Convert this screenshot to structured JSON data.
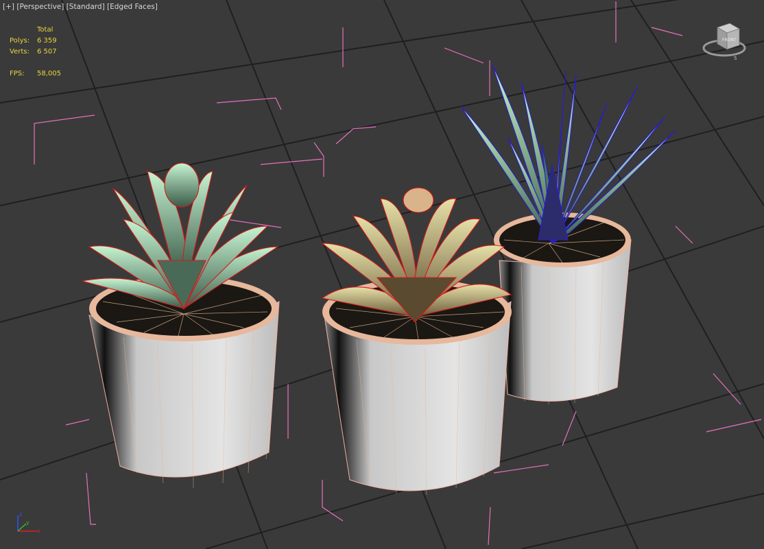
{
  "viewport": {
    "labels": [
      "[+]",
      "[Perspective]",
      "[Standard]",
      "[Edged Faces]"
    ]
  },
  "stats": {
    "header": "Total",
    "polys_label": "Polys:",
    "polys_value": "6 359",
    "verts_label": "Verts:",
    "verts_value": "6 507",
    "fps_label": "FPS:",
    "fps_value": "58,005"
  },
  "viewcube": {
    "face_label": "FRONT",
    "compass_label": "S",
    "icon": "viewcube-icon"
  },
  "axis_tripod": {
    "x_label": "x",
    "y_label": "y",
    "z_label": "z"
  },
  "colors": {
    "background": "#3a3a3a",
    "grid": "#1e1e1e",
    "bbox": "#e870c0",
    "wire_selected": "#e02020",
    "wire_agave": "#2a1ec8",
    "leaf_green": "#a8e6b8",
    "pot": "#d6d6d6",
    "soil": "#1a1612",
    "stats_text": "#e8d640"
  },
  "scene": {
    "objects": [
      "succulent-left",
      "succulent-middle",
      "agave-right"
    ]
  }
}
